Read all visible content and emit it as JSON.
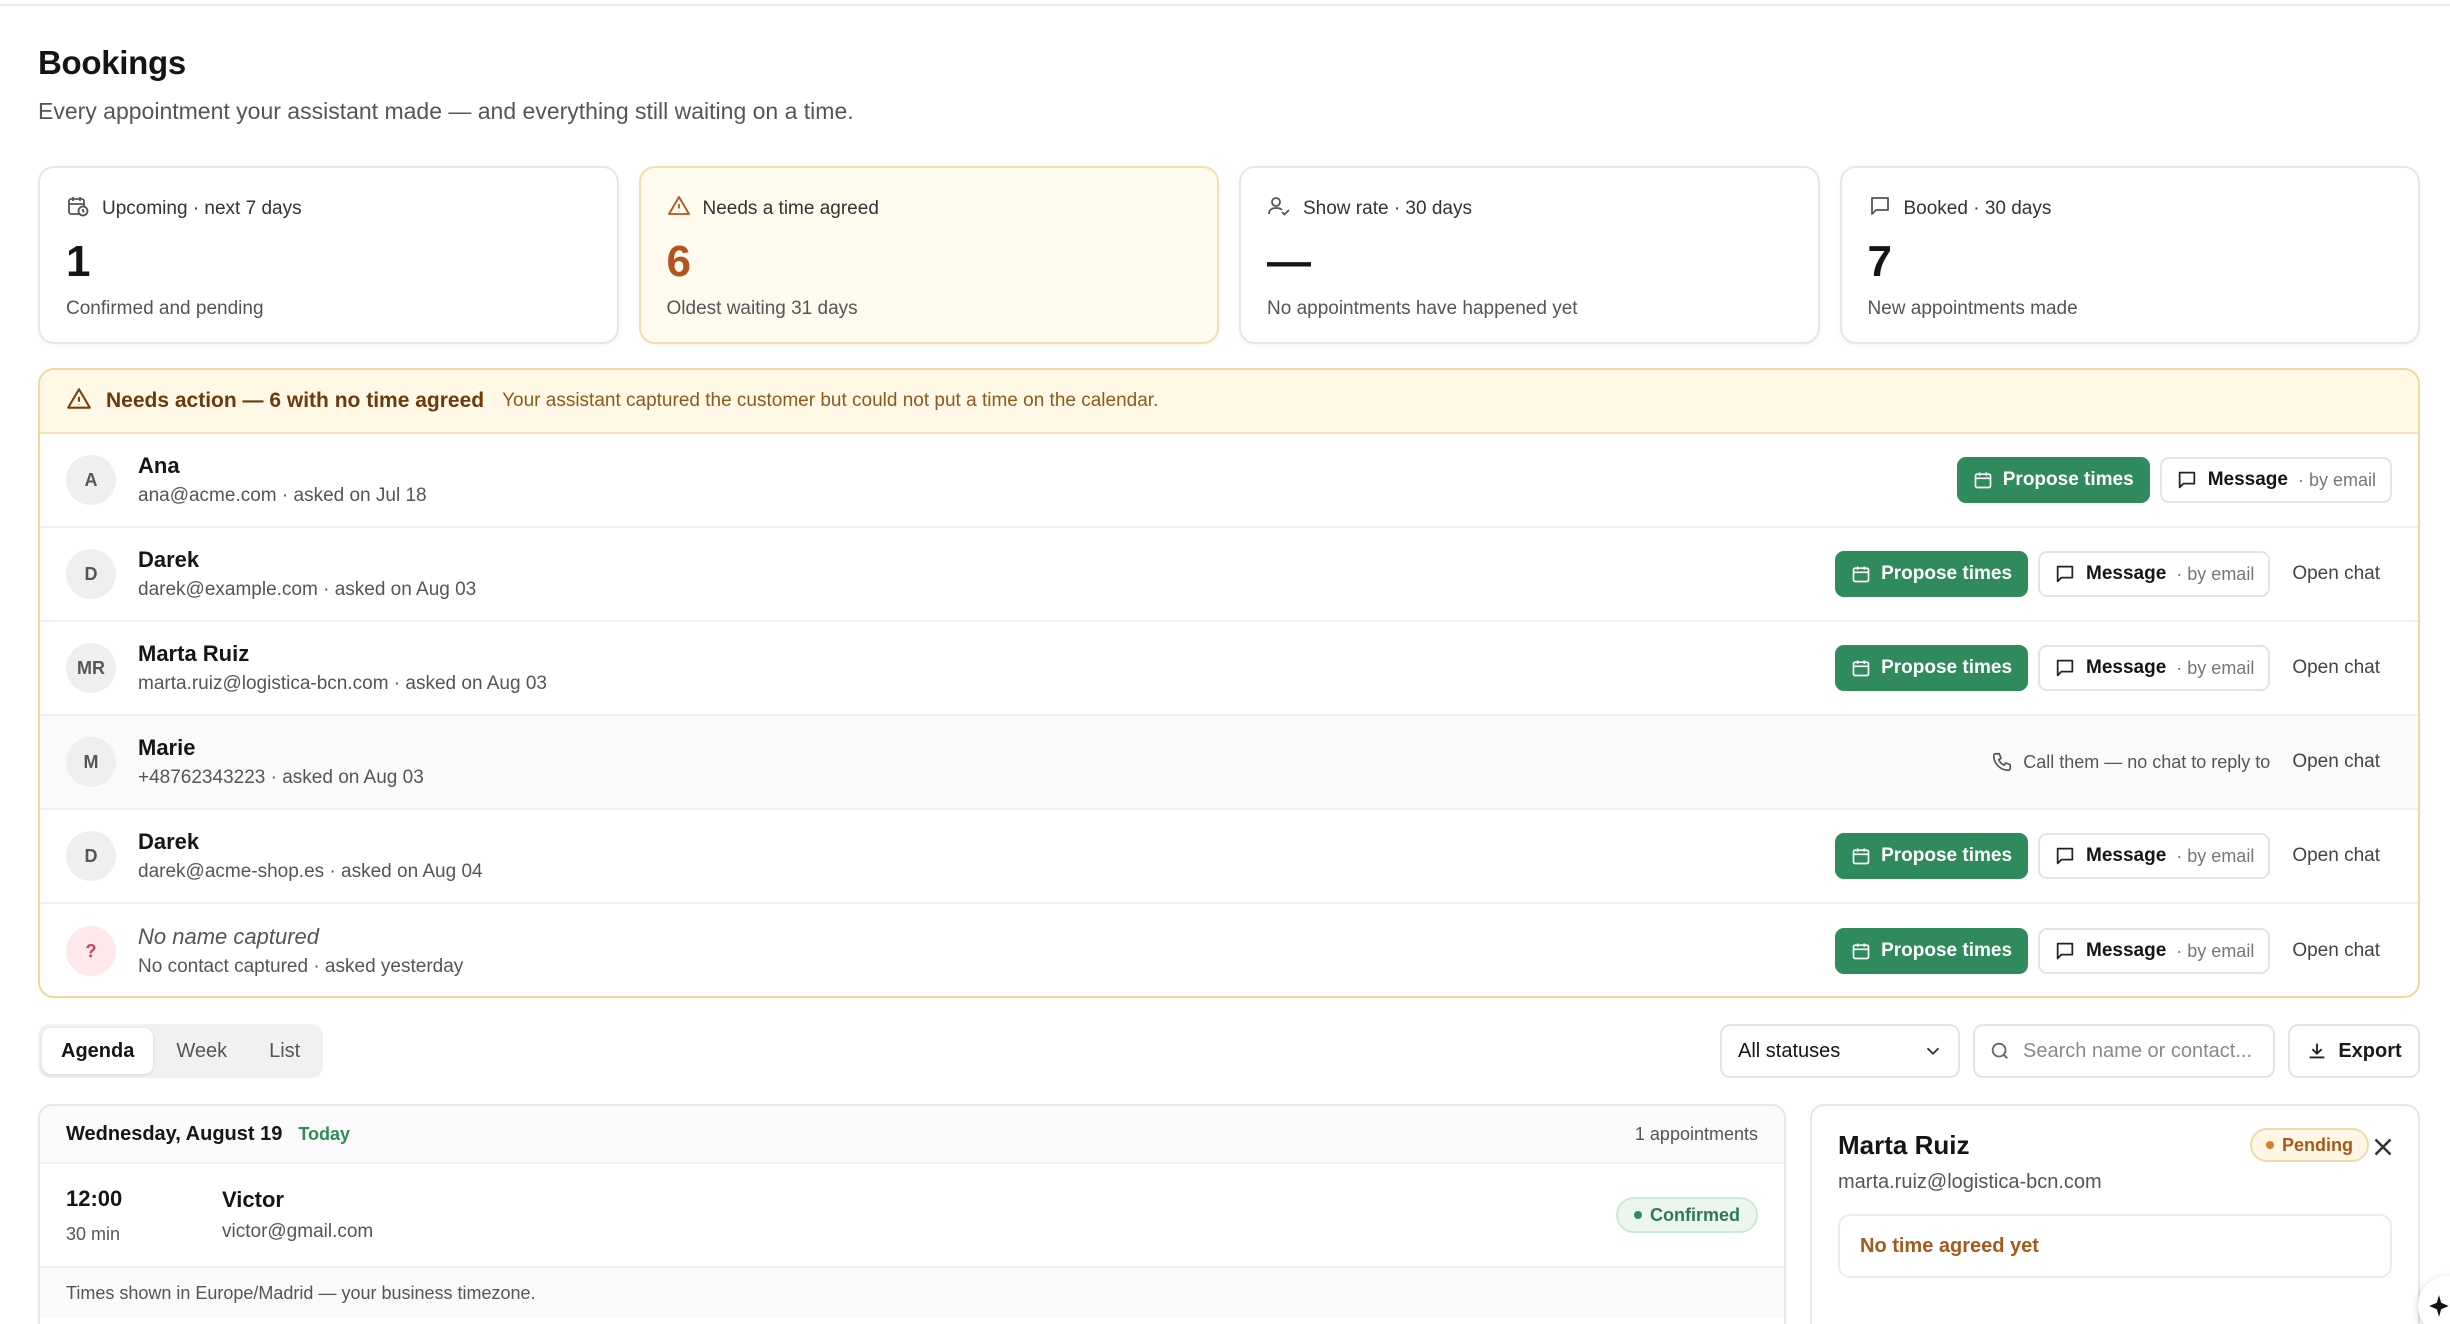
{
  "page": {
    "title": "Bookings",
    "subtitle": "Every appointment your assistant made — and everything still waiting on a time."
  },
  "stats": [
    {
      "label": "Upcoming · next 7 days",
      "value": "1",
      "note": "Confirmed and pending",
      "icon": "calendar-clock-icon"
    },
    {
      "label": "Needs a time agreed",
      "value": "6",
      "note": "Oldest waiting 31 days",
      "icon": "warning-icon"
    },
    {
      "label": "Show rate · 30 days",
      "value": "—",
      "note": "No appointments have happened yet",
      "icon": "user-check-icon"
    },
    {
      "label": "Booked · 30 days",
      "value": "7",
      "note": "New appointments made",
      "icon": "message-icon"
    }
  ],
  "needs_action": {
    "title": "Needs action — 6 with no time agreed",
    "description": "Your assistant captured the customer but could not put a time on the calendar.",
    "propose_label": "Propose times",
    "message_label": "Message",
    "by_email": "· by email",
    "open_chat": "Open chat",
    "call_note": "Call them — no chat to reply to",
    "rows": [
      {
        "initials": "A",
        "name": "Ana",
        "sub": "ana@acme.com · asked on Jul 18"
      },
      {
        "initials": "D",
        "name": "Darek",
        "sub": "darek@example.com · asked on Aug 03"
      },
      {
        "initials": "MR",
        "name": "Marta Ruiz",
        "sub": "marta.ruiz@logistica-bcn.com · asked on Aug 03"
      },
      {
        "initials": "M",
        "name": "Marie",
        "sub": "+48762343223 · asked on Aug 03"
      },
      {
        "initials": "D",
        "name": "Darek",
        "sub": "darek@acme-shop.es · asked on Aug 04"
      },
      {
        "initials": "?",
        "name": "No name captured",
        "sub": "No contact captured · asked yesterday"
      }
    ]
  },
  "toolbar": {
    "tabs": [
      "Agenda",
      "Week",
      "List"
    ],
    "status_select": "All statuses",
    "search_placeholder": "Search name or contact...",
    "export_label": "Export"
  },
  "agenda": {
    "day": "Wednesday, August 19",
    "today": "Today",
    "count": "1 appointments",
    "appointment": {
      "time": "12:00",
      "duration": "30 min",
      "name": "Victor",
      "email": "victor@gmail.com",
      "status": "Confirmed"
    },
    "footer": "Times shown in Europe/Madrid — your business timezone."
  },
  "detail": {
    "name": "Marta Ruiz",
    "email": "marta.ruiz@logistica-bcn.com",
    "status": "Pending",
    "note": "No time agreed yet"
  },
  "colors": {
    "accent_green": "#2f8a5c",
    "warning_orange": "#b3541e",
    "warning_bg": "#fff8e6"
  }
}
